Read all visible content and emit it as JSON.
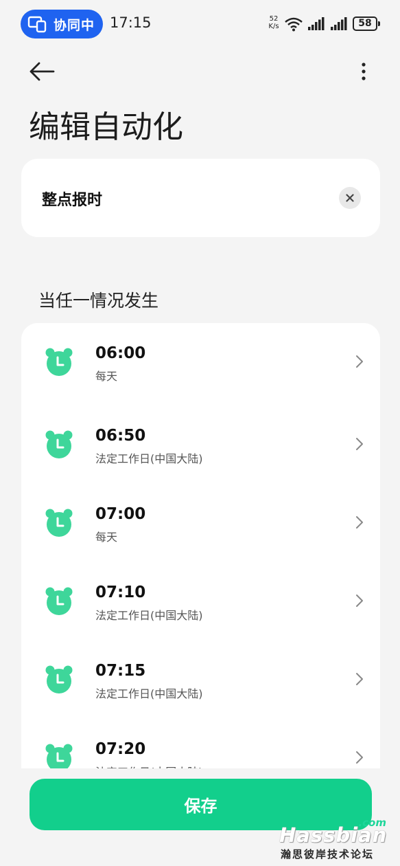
{
  "status_bar": {
    "cast_label": "协同中",
    "time": "17:15",
    "net_speed_value": "52",
    "net_speed_unit": "K/s",
    "battery": "58"
  },
  "header": {
    "back_icon": "arrow-left-icon",
    "more_icon": "more-vertical-icon"
  },
  "page_title": "编辑自动化",
  "automation_name": "整点报时",
  "trigger_section_label": "当任一情况发生",
  "triggers": [
    {
      "time": "06:00",
      "repeat": "每天"
    },
    {
      "time": "06:50",
      "repeat": "法定工作日(中国大陆)"
    },
    {
      "time": "07:00",
      "repeat": "每天"
    },
    {
      "time": "07:10",
      "repeat": "法定工作日(中国大陆)"
    },
    {
      "time": "07:15",
      "repeat": "法定工作日(中国大陆)"
    },
    {
      "time": "07:20",
      "repeat": "法定工作日(中国大陆)"
    }
  ],
  "save_label": "保存",
  "watermark": {
    "com": ".com",
    "brand": "Hassbian",
    "subtitle": "瀚思彼岸技术论坛"
  },
  "colors": {
    "accent": "#12cf8c",
    "alarm_icon": "#3ed69a",
    "cast_pill": "#1f63f0",
    "background": "#f4f4f4"
  }
}
